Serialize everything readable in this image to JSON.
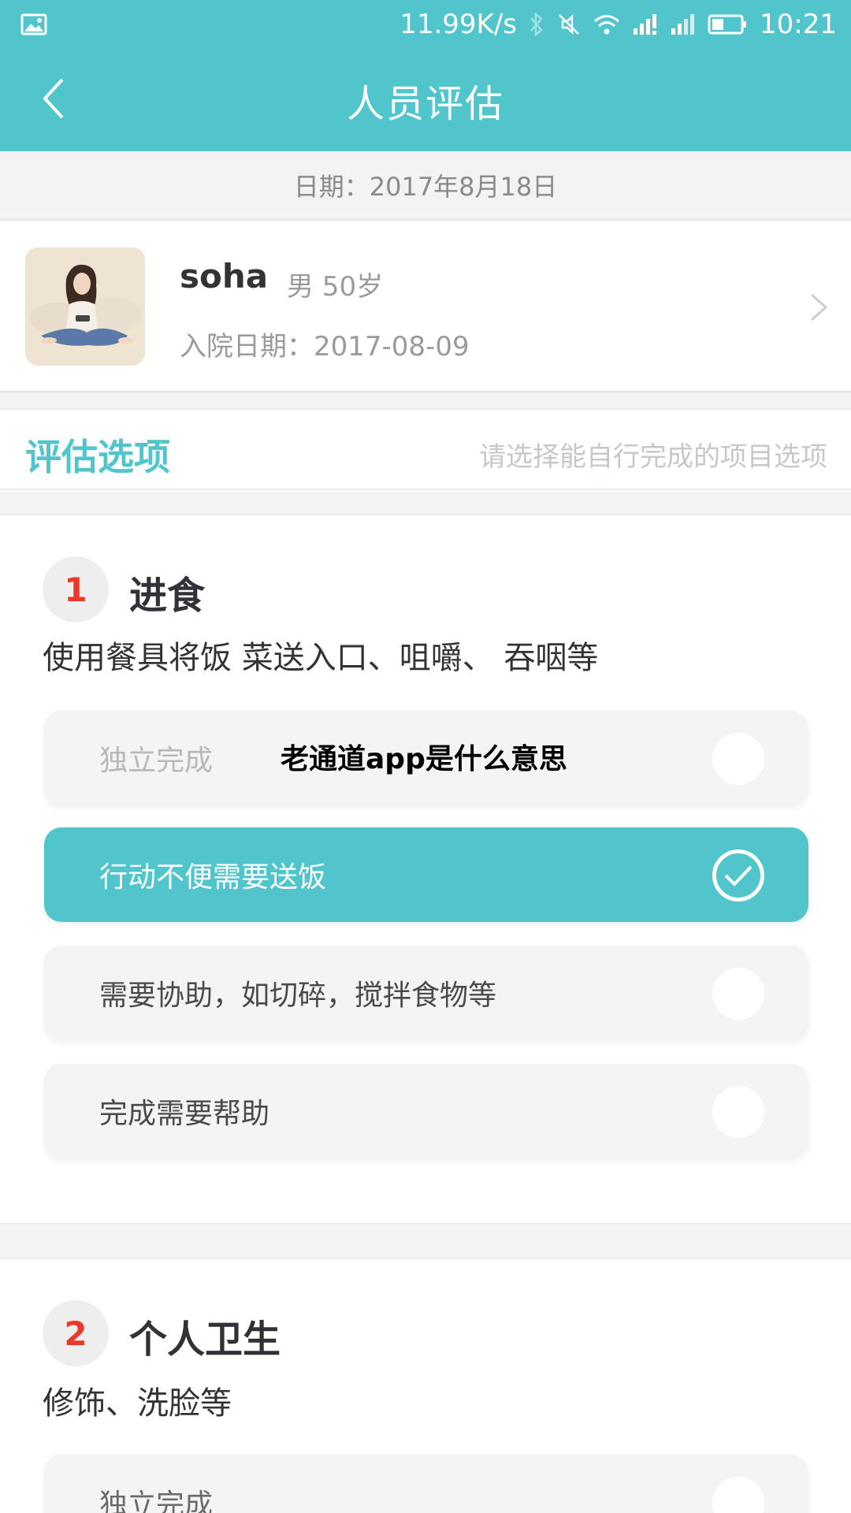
{
  "status_bar": {
    "net_speed": "11.99K/s",
    "time": "10:21",
    "icons": [
      "image-icon",
      "bluetooth-icon",
      "mute-icon",
      "wifi-icon",
      "signal-icon",
      "signal-icon-2",
      "battery-icon"
    ]
  },
  "header": {
    "title": "人员评估",
    "back_icon": "chevron-left-icon",
    "color": "#50c5cb"
  },
  "date_bar": {
    "text": "日期：2017年8月18日"
  },
  "person": {
    "name": "soha",
    "meta": "男 50岁",
    "admit": "入院日期：2017-08-09"
  },
  "options_header": {
    "title": "评估选项",
    "hint": "请选择能自行完成的项目选项"
  },
  "sections": [
    {
      "number": "1",
      "title": "进食",
      "desc": "使用餐具将饭 菜送入口、咀嚼、 吞咽等",
      "options": [
        {
          "label": "独立完成",
          "selected": false
        },
        {
          "label": "行动不便需要送饭",
          "selected": true
        },
        {
          "label": "需要协助，如切碎，搅拌食物等",
          "selected": false
        },
        {
          "label": "完成需要帮助",
          "selected": false
        }
      ]
    },
    {
      "number": "2",
      "title": "个人卫生",
      "desc": "修饰、洗脸等",
      "options": [
        {
          "label": "独立完成",
          "selected": false
        }
      ]
    }
  ],
  "watermark": "老通道app是什么意思",
  "colors": {
    "accent": "#50c5cb",
    "number": "#e8392b"
  }
}
